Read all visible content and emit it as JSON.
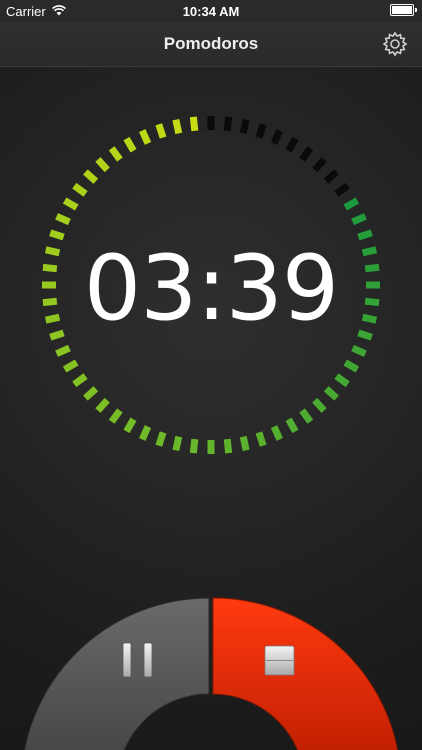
{
  "status_bar": {
    "carrier": "Carrier",
    "time": "10:34 AM"
  },
  "nav": {
    "title": "Pomodoros",
    "settings_icon": "gear-icon"
  },
  "timer": {
    "display": "03:39",
    "total_ticks": 60,
    "elapsed_ticks": 10
  },
  "controls": {
    "pause_icon": "pause-icon",
    "stop_icon": "stop-icon",
    "pause_color": "#555555",
    "stop_color": "#e32a00"
  },
  "colors": {
    "ring_start": "#c8dc14",
    "ring_end": "#1e9a3c",
    "ring_inactive": "#0a0a0a"
  }
}
